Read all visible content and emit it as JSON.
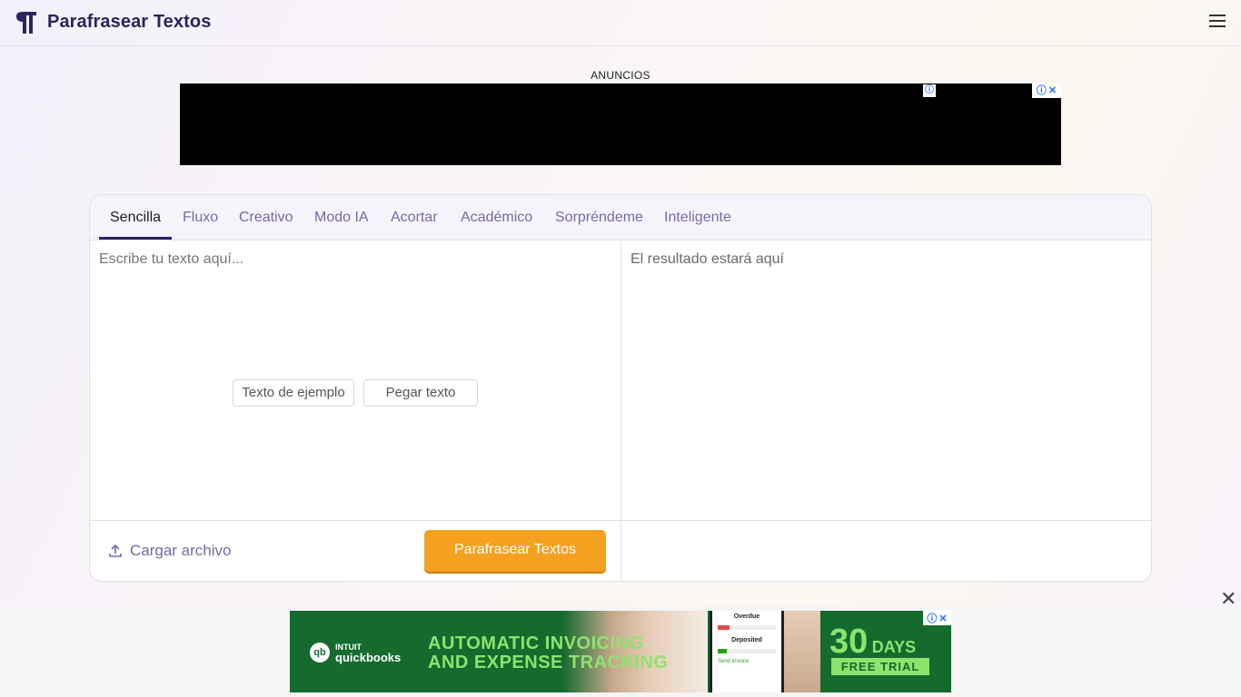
{
  "header": {
    "brand": "Parafrasear Textos",
    "logo_icon": "pilcrow-icon",
    "menu_icon": "hamburger-menu-icon"
  },
  "ads": {
    "label": "ANUNCIOS",
    "top_info_icon": "ⓘ",
    "close_glyph": "✕",
    "bottom": {
      "brand_small": "INTUIT",
      "brand": "quickbooks",
      "headline_1": "AUTOMATIC INVOICING",
      "headline_2": "AND EXPENSE TRACKING",
      "days_number": "30",
      "days_word": "DAYS",
      "trial": "FREE TRIAL",
      "phone_title": "Overdue",
      "phone_title_2": "Deposited",
      "phone_link": "Send invoice"
    },
    "bottom_close": "✕"
  },
  "tabs": [
    {
      "label": "Sencilla",
      "active": true
    },
    {
      "label": "Fluxo",
      "active": false
    },
    {
      "label": "Creativo",
      "active": false
    },
    {
      "label": "Modo IA",
      "active": false
    },
    {
      "label": "Acortar",
      "active": false
    },
    {
      "label": "Académico",
      "active": false
    },
    {
      "label": "Sorpréndeme",
      "active": false
    },
    {
      "label": "Inteligente",
      "active": false
    }
  ],
  "editor": {
    "input_placeholder": "Escribe tu texto aquí...",
    "input_value": "",
    "output_placeholder": "El resultado estará aquí",
    "sample_button": "Texto de ejemplo",
    "paste_button": "Pegar texto",
    "upload_label": "Cargar archivo",
    "submit_button": "Parafrasear Textos"
  },
  "colors": {
    "brand": "#2b2360",
    "tab_inactive": "#7a68a6",
    "primary_button": "#f4a11f"
  }
}
